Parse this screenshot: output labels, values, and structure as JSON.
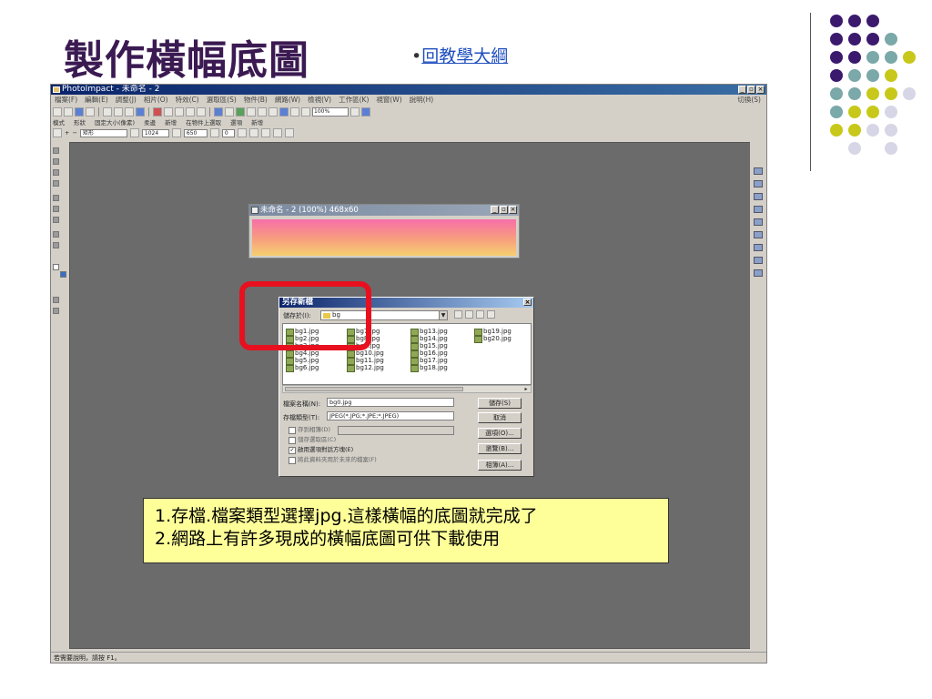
{
  "slide": {
    "title": "製作橫幅底圖",
    "back_link_bullet": "•",
    "back_link": "回教學大綱"
  },
  "colors": {
    "title": "#3b1a52",
    "accent_purple": "#3b1a6e",
    "accent_teal": "#7ba8a8",
    "accent_yellow": "#c8c81a",
    "accent_lavender": "#d6d6e6",
    "highlight_box": "#e8101f",
    "callout_bg": "#ffff99"
  },
  "app": {
    "title": "PhotoImpact - 未命名 - 2",
    "menu": [
      "檔案(F)",
      "編輯(E)",
      "調整(J)",
      "相片(O)",
      "特效(C)",
      "選取區(S)",
      "物件(B)",
      "網路(W)",
      "檢視(V)",
      "工作區(K)",
      "視窗(W)",
      "說明(H)"
    ],
    "menu_right": "切換(S)",
    "zoom_combo": "100%",
    "toolbar2_labels": [
      "模式",
      "形狀",
      "固定大小(像素)",
      "柔邊",
      "新增",
      "在物件上選取",
      "選項",
      "新增"
    ],
    "shape_combo": "矩形",
    "width_value": "1024",
    "height_value": "650",
    "status": "若需要說明，請按 F1。"
  },
  "image_window": {
    "title": "未命名 - 2 (100%) 468x60"
  },
  "save_dialog": {
    "title": "另存新檔",
    "save_in_label": "儲存於(I):",
    "save_in_value": "bg",
    "files": [
      "bg1.jpg",
      "bg2.jpg",
      "bg3.jpg",
      "bg4.jpg",
      "bg5.jpg",
      "bg6.jpg",
      "bg7.jpg",
      "bg8.jpg",
      "bg9.jpg",
      "bg10.jpg",
      "bg11.jpg",
      "bg12.jpg",
      "bg13.jpg",
      "bg14.jpg",
      "bg15.jpg",
      "bg16.jpg",
      "bg17.jpg",
      "bg18.jpg",
      "bg19.jpg",
      "bg20.jpg"
    ],
    "filename_label": "檔案名稱(N):",
    "filename_value": "bg0.jpg",
    "filetype_label": "存檔類型(T):",
    "filetype_value": "JPEG(*.JPG;*.JPE;*.JPEG)",
    "option1": "存到相簿(D)",
    "option2": "儲存選取區(C)",
    "option3": "啟用選項對話方塊(E)",
    "option4": "將此資料夾用於未來的檔案(F)",
    "btn_save": "儲存(S)",
    "btn_cancel": "取消",
    "btn_options": "選項(O)...",
    "btn_browse": "瀏覽(B)...",
    "btn_album": "相簿(A)..."
  },
  "callout": {
    "line1": "1.存檔.檔案類型選擇jpg.這樣橫幅的底圖就完成了",
    "line2": "2.網路上有許多現成的橫幅底圖可供下載使用"
  }
}
